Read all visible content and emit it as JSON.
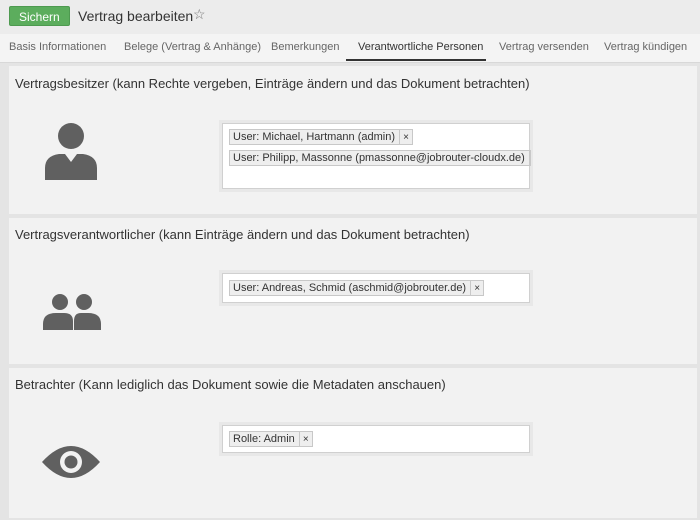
{
  "header": {
    "save_label": "Sichern",
    "title": "Vertrag bearbeiten",
    "star_glyph": "☆"
  },
  "tabs": [
    {
      "label": "Basis Informationen"
    },
    {
      "label": "Belege (Vertrag & Anhänge)"
    },
    {
      "label": "Bemerkungen"
    },
    {
      "label": "Verantwortliche Personen",
      "active": true
    },
    {
      "label": "Vertrag versenden"
    },
    {
      "label": "Vertrag kündigen"
    }
  ],
  "sections": [
    {
      "title": "Vertragsbesitzer (kann Rechte vergeben, Einträge ändern und das Dokument betrachten)",
      "icon": "person-icon",
      "tags": [
        {
          "label": "User: Michael, Hartmann (admin)",
          "remove": "×"
        },
        {
          "label": "User: Philipp, Massonne (pmassonne@jobrouter-cloudx.de)",
          "remove": "×"
        }
      ]
    },
    {
      "title": "Vertragsverantwortlicher (kann Einträge ändern und das Dokument betrachten)",
      "icon": "group-icon",
      "tags": [
        {
          "label": "User: Andreas, Schmid (aschmid@jobrouter.de)",
          "remove": "×"
        }
      ]
    },
    {
      "title": "Betrachter (Kann lediglich das Dokument sowie die Metadaten anschauen)",
      "icon": "eye-icon",
      "tags": [
        {
          "label": "Rolle: Admin",
          "remove": "×"
        }
      ]
    }
  ],
  "colors": {
    "save_green": "#5cad5d",
    "icon_gray": "#606060"
  }
}
